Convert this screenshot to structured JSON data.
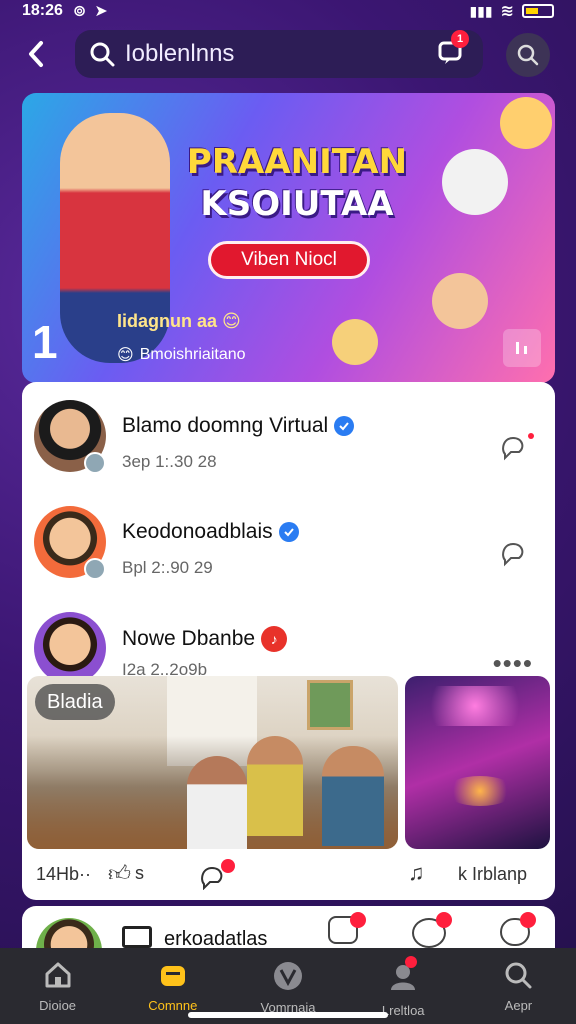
{
  "status": {
    "time": "18:26"
  },
  "search": {
    "query": "Ioblenlnns",
    "msg_badge": "1"
  },
  "banner": {
    "title_line1": "PRAANITAN",
    "title_line2": "KSOIUTAA",
    "cta": "Viben Niocl",
    "subline": "Iidagnun aa",
    "subline2": "Bmoishriaitano",
    "page_number": "1"
  },
  "feed": {
    "rows": [
      {
        "name": "Blamo doomng Virtual",
        "meta": "3ep   1:.30 28"
      },
      {
        "name": "Keodonoadblais",
        "meta": "Bpl   2:.90 29"
      },
      {
        "name": "Nowe Dbanbe",
        "meta": "I2a   2..2o9b"
      }
    ],
    "photo_tag": "Bladia",
    "actions": {
      "likes": "14Hb··",
      "like_s": "s",
      "right_label": "k Irblanp"
    }
  },
  "next_post": {
    "title": "erkoadatlas"
  },
  "bottom_nav": [
    {
      "label": "Dioioe"
    },
    {
      "label": "Comnne"
    },
    {
      "label": "Vomrnaia"
    },
    {
      "label": "Lreltloa"
    },
    {
      "label": "Aepr"
    }
  ],
  "colors": {
    "accent": "#ffc21a",
    "badge": "#ff1f3d",
    "verified": "#2a7cf2",
    "nav_bg": "#2a2a30"
  }
}
